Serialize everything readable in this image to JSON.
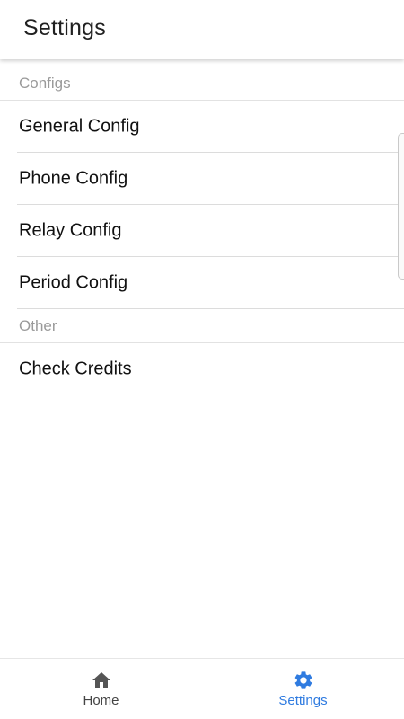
{
  "app_bar": {
    "title": "Settings"
  },
  "sections": {
    "configs": {
      "header": "Configs",
      "items": [
        {
          "label": "General Config"
        },
        {
          "label": "Phone Config"
        },
        {
          "label": "Relay Config"
        },
        {
          "label": "Period Config"
        }
      ]
    },
    "other": {
      "header": "Other",
      "items": [
        {
          "label": "Check Credits"
        }
      ]
    }
  },
  "bottom_nav": {
    "items": [
      {
        "label": "Home",
        "icon": "home-icon",
        "active": false
      },
      {
        "label": "Settings",
        "icon": "gear-icon",
        "active": true
      }
    ]
  },
  "colors": {
    "accent": "#2f7be0",
    "inactive": "#444444",
    "section_header": "#9a9a9a"
  }
}
